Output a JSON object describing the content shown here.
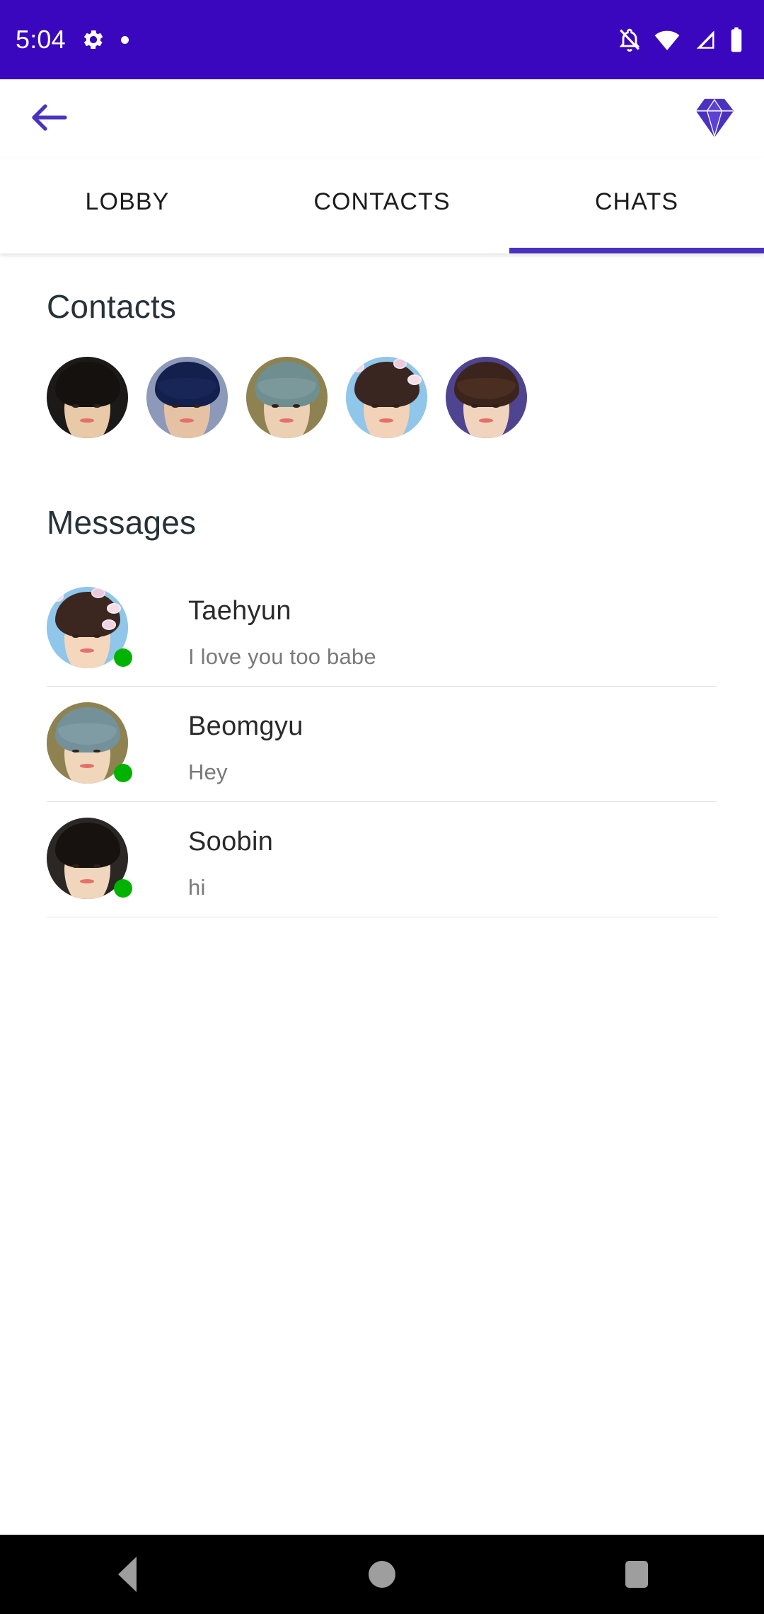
{
  "status_bar": {
    "time": "5:04",
    "left_icons": [
      "gear-icon",
      "dot-indicator"
    ],
    "right_icons": [
      "notifications-off-icon",
      "wifi-icon",
      "cellular-signal-icon",
      "battery-icon"
    ],
    "background_color": "#3A07BF"
  },
  "app_bar": {
    "back_icon": "arrow-left-icon",
    "brand_icon": "diamond-gem-icon",
    "accent_color": "#4A32BF"
  },
  "tabs": {
    "items": [
      {
        "label": "LOBBY",
        "active": false
      },
      {
        "label": "CONTACTS",
        "active": false
      },
      {
        "label": "CHATS",
        "active": true
      }
    ],
    "indicator_color": "#4A32BF"
  },
  "contacts": {
    "title": "Contacts",
    "avatars": [
      {
        "name": "contact-avatar-1",
        "bg": "#1b1a18",
        "skin": "#e8c9a8",
        "hair": "#15110e"
      },
      {
        "name": "contact-avatar-2",
        "bg": "#8c99b8",
        "skin": "#e6c2a4",
        "hair": "#131f4d"
      },
      {
        "name": "contact-avatar-3",
        "bg": "#8d8250",
        "skin": "#ecd0b4",
        "hair": "#6f8e90"
      },
      {
        "name": "contact-avatar-4",
        "bg": "#8fc6ea",
        "skin": "#f2d2b8",
        "hair": "#3a2620"
      },
      {
        "name": "contact-avatar-5",
        "bg": "#4e4490",
        "skin": "#f0d4be",
        "hair": "#3b241c"
      }
    ]
  },
  "messages": {
    "title": "Messages",
    "online_color": "#00b300",
    "items": [
      {
        "name": "Taehyun",
        "preview": "I love you too babe",
        "online": true,
        "avatar": {
          "bg": "#8fc6ea",
          "skin": "#f5d7bd",
          "hair": "#3b2720",
          "flowers": true
        }
      },
      {
        "name": "Beomgyu",
        "preview": "Hey",
        "online": true,
        "avatar": {
          "bg": "#8d8250",
          "skin": "#f0d6bb",
          "hair": "#74919a",
          "flowers": false
        }
      },
      {
        "name": "Soobin",
        "preview": "hi",
        "online": true,
        "avatar": {
          "bg": "#2a2724",
          "skin": "#f0d6bd",
          "hair": "#17120f",
          "flowers": false
        }
      }
    ]
  },
  "nav_bar": {
    "buttons": [
      {
        "name": "nav-back-button",
        "icon": "triangle-back-icon"
      },
      {
        "name": "nav-home-button",
        "icon": "circle-home-icon"
      },
      {
        "name": "nav-recents-button",
        "icon": "square-recents-icon"
      }
    ],
    "icon_color": "#9e9e9e",
    "background_color": "#000000"
  }
}
